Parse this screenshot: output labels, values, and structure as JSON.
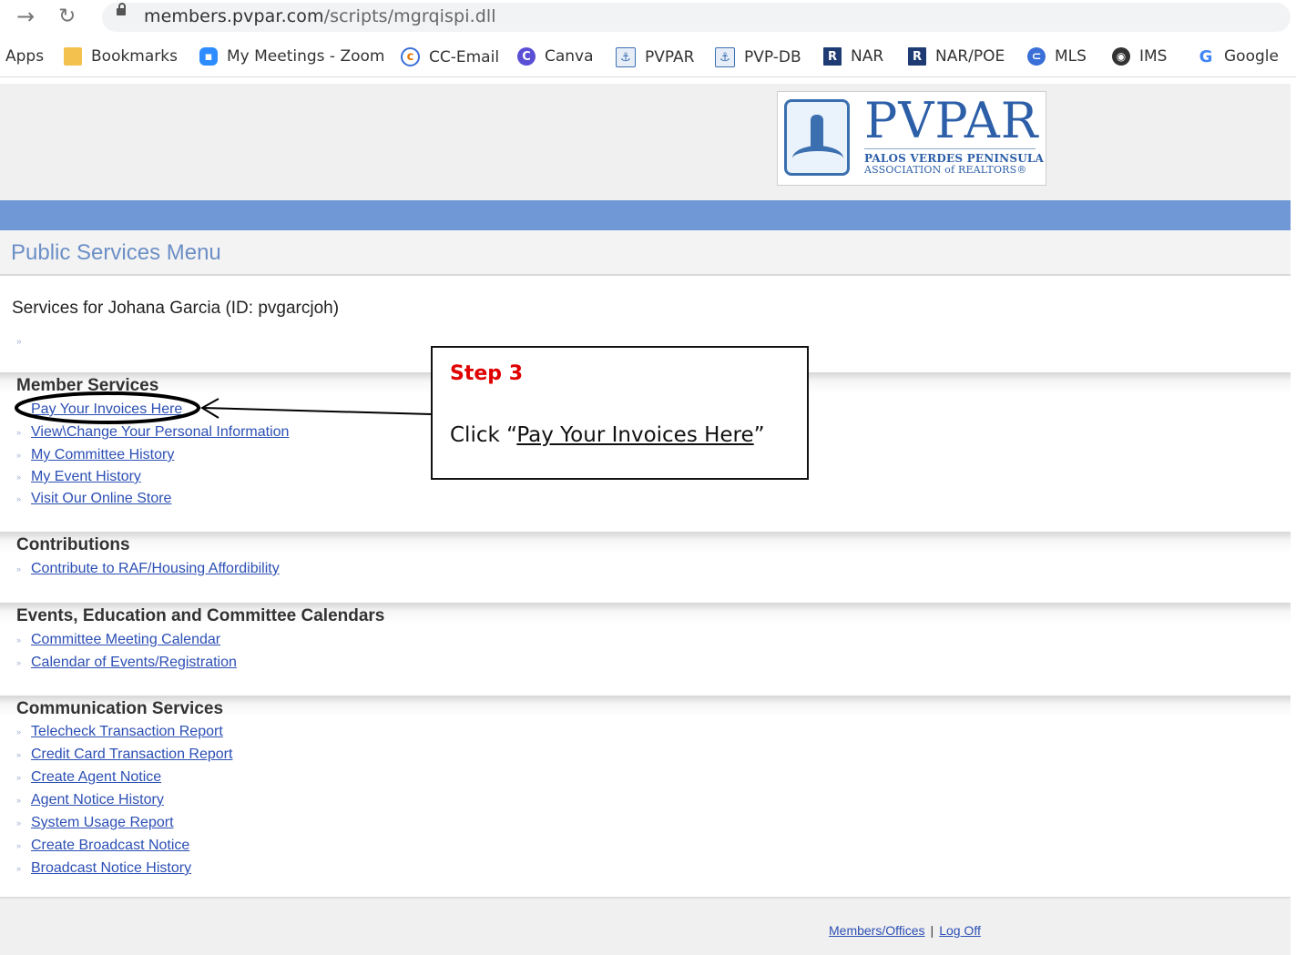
{
  "browser": {
    "url_host": "members.pvpar.com",
    "url_path": "/scripts/mgrqispi.dll",
    "bookmarks": [
      {
        "label": "Apps",
        "icon": "apps-icon"
      },
      {
        "label": "Bookmarks",
        "icon": "folder-icon"
      },
      {
        "label": "My Meetings - Zoom",
        "icon": "zoom-icon"
      },
      {
        "label": "CC-Email",
        "icon": "cc-email-icon"
      },
      {
        "label": "Canva",
        "icon": "canva-icon"
      },
      {
        "label": "PVPAR",
        "icon": "pvpar-icon"
      },
      {
        "label": "PVP-DB",
        "icon": "pvpdb-icon"
      },
      {
        "label": "NAR",
        "icon": "nar-icon"
      },
      {
        "label": "NAR/POE",
        "icon": "narpoe-icon"
      },
      {
        "label": "MLS",
        "icon": "mls-icon"
      },
      {
        "label": "IMS",
        "icon": "globe-icon"
      },
      {
        "label": "Google",
        "icon": "google-icon"
      }
    ]
  },
  "header": {
    "logo_main": "PVPAR",
    "logo_line1": "PALOS VERDES PENINSULA",
    "logo_line2": "ASSOCIATION of REALTORS®",
    "menu_title": "Public Services Menu"
  },
  "services_for": "Services for Johana Garcia (ID: pvgarcjoh)",
  "sections": [
    {
      "title": "Member Services",
      "links": [
        "Pay Your Invoices Here",
        "View\\Change Your Personal Information",
        "My Committee History",
        "My Event History",
        "Visit Our Online Store"
      ]
    },
    {
      "title": "Contributions",
      "links": [
        "Contribute to RAF/Housing Affordibility"
      ]
    },
    {
      "title": "Events, Education and Committee Calendars",
      "links": [
        "Committee Meeting Calendar",
        "Calendar of Events/Registration"
      ]
    },
    {
      "title": "Communication Services",
      "links": [
        "Telecheck Transaction Report",
        "Credit Card Transaction Report",
        "Create Agent Notice",
        "Agent Notice History",
        "System Usage Report",
        "Create Broadcast Notice",
        "Broadcast Notice History"
      ]
    }
  ],
  "callout": {
    "title": "Step 3",
    "prefix": "Click “",
    "link_text": "Pay Your Invoices Here",
    "suffix": "”"
  },
  "footer": {
    "members_offices": "Members/Offices",
    "separator": "|",
    "log_off": "Log Off"
  },
  "colors": {
    "accent_bar": "#7098d6",
    "link": "#2c4fb4",
    "menu_title": "#6c8fc6",
    "callout_title": "#e00000"
  }
}
